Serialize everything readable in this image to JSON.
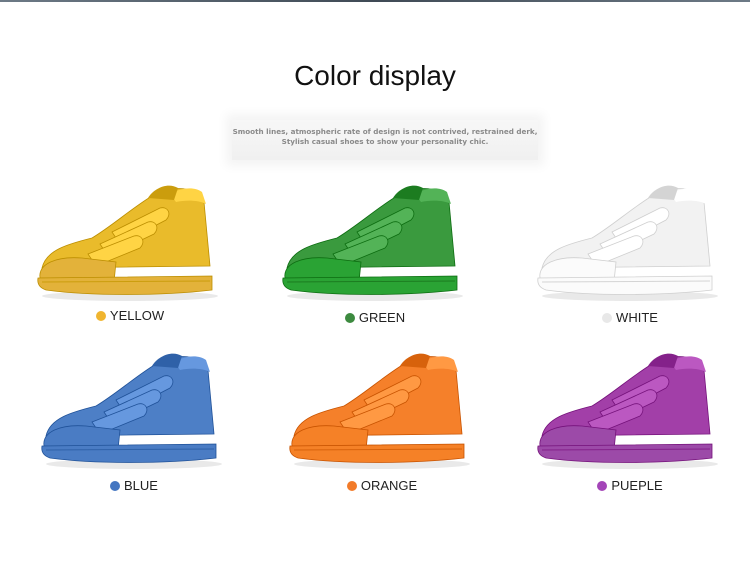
{
  "title": "Color display",
  "subtitle": {
    "line1": "Smooth lines, atmospheric rate of design is not contrived, restrained derk,",
    "line2": "Stylish casual shoes to show your personality chic."
  },
  "products": [
    {
      "label": "YELLOW",
      "color": "#e9bb2b",
      "sole": "#e3b23a",
      "swatch": "#f0b530"
    },
    {
      "label": "GREEN",
      "color": "#3a9a3e",
      "sole": "#2aa334",
      "swatch": "#3c8a3f"
    },
    {
      "label": "WHITE",
      "color": "#f2f2f2",
      "sole": "#fbfbfb",
      "swatch": "#e8e8e8"
    },
    {
      "label": "BLUE",
      "color": "#4d7fc6",
      "sole": "#4a7cc4",
      "swatch": "#4476c1"
    },
    {
      "label": "ORANGE",
      "color": "#f5802a",
      "sole": "#f58127",
      "swatch": "#f27b29"
    },
    {
      "label": "PUEPLE",
      "color": "#a23fa8",
      "sole": "#9c4aa8",
      "swatch": "#a445b8"
    }
  ]
}
